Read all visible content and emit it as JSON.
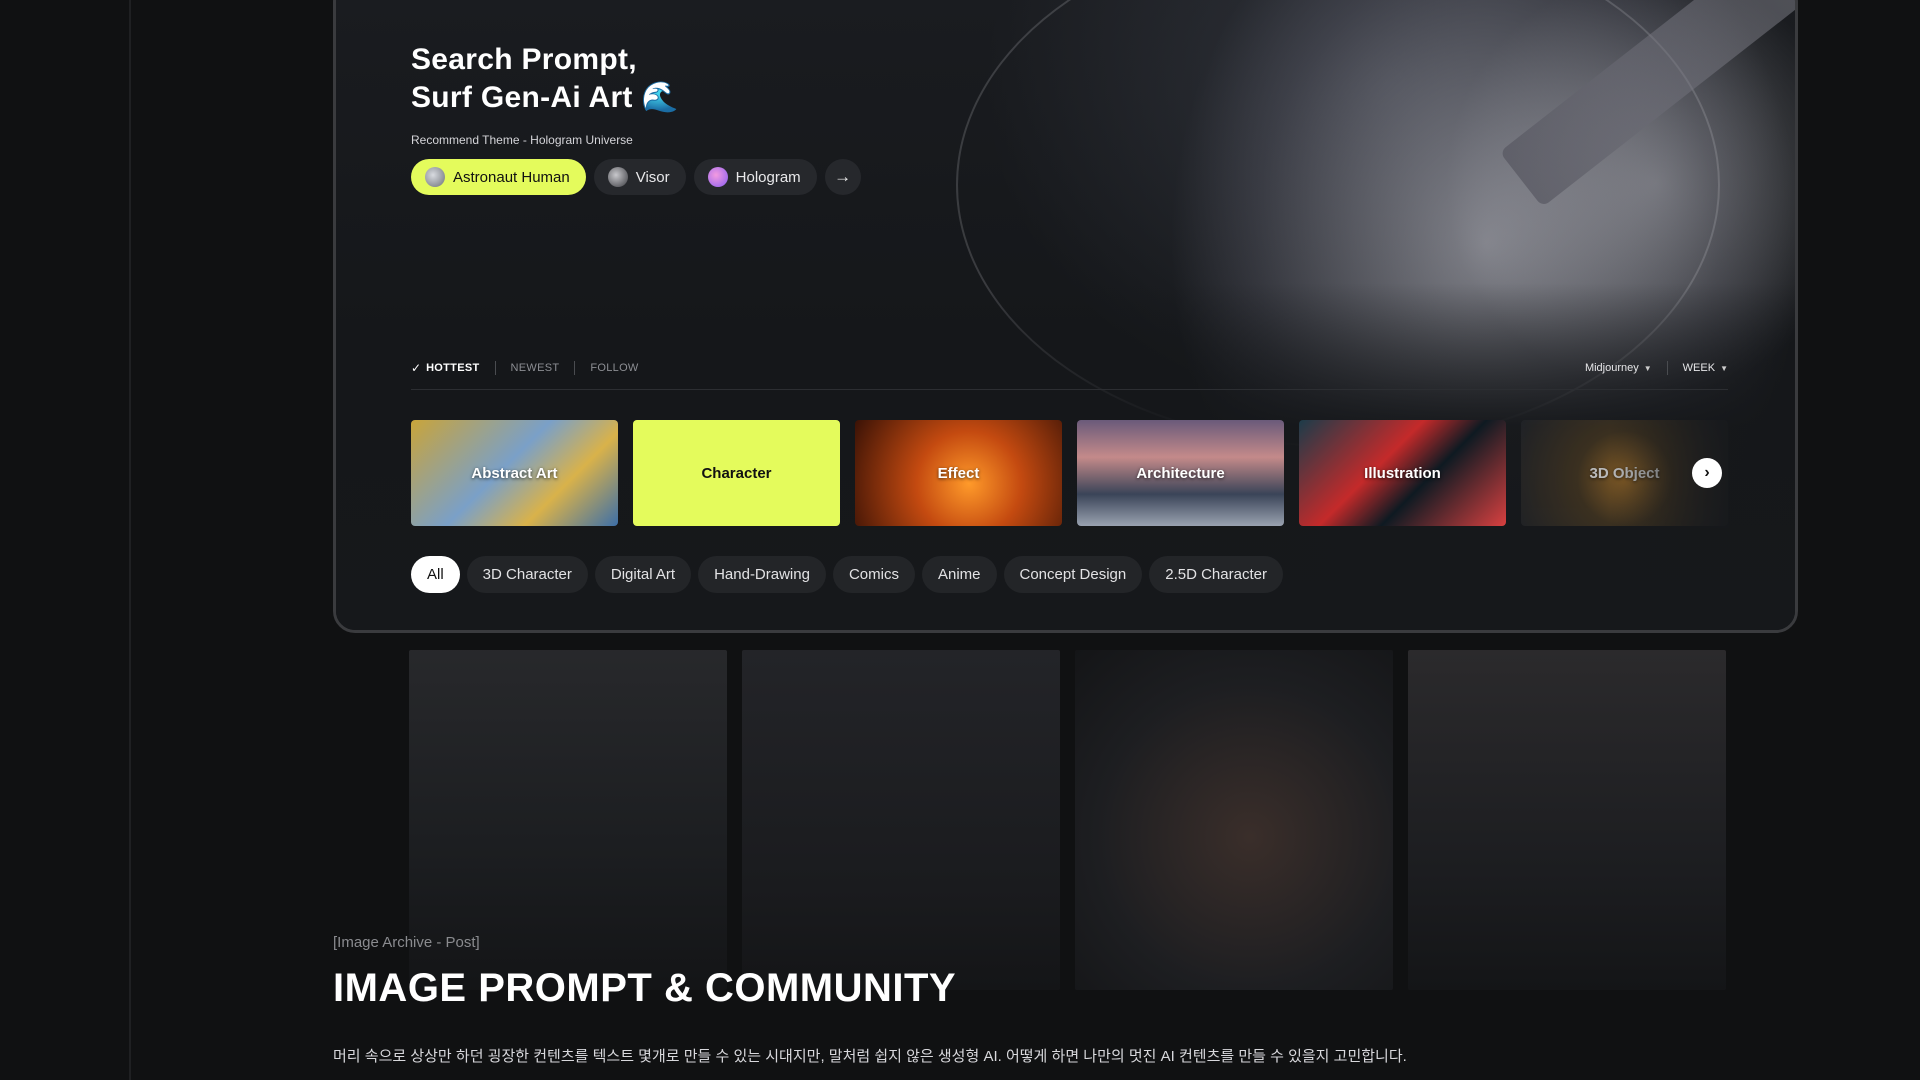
{
  "hero": {
    "title_line1": "Search Prompt,",
    "title_line2": "Surf Gen-Ai Art",
    "title_emoji": "🌊",
    "theme_label": "Recommend Theme - Hologram Universe",
    "chips": [
      {
        "label": "Astronaut Human",
        "active": true,
        "avatar_color": "#8a8f98"
      },
      {
        "label": "Visor",
        "active": false,
        "avatar_color": "#6a6c72"
      },
      {
        "label": "Hologram",
        "active": false,
        "avatar_color": "#c37cf0"
      }
    ],
    "chips_next_icon": "arrow-right-icon"
  },
  "sort": {
    "check_icon": "✓",
    "hottest": "HOTTEST",
    "newest": "NEWEST",
    "follow": "FOLLOW",
    "model": "Midjourney",
    "period": "WEEK",
    "caret": "⌄"
  },
  "categories": [
    {
      "label": "Abstract Art",
      "active": false,
      "bg": "linear-gradient(135deg,#c9a43a 0%,#7aa0c8 45%,#d9b24a 70%,#3d6fa8 100%)"
    },
    {
      "label": "Character",
      "active": true,
      "bg": "#e4fb5c"
    },
    {
      "label": "Effect",
      "active": false,
      "bg": "radial-gradient(circle at 55% 60%,#ff9a2a 0%,#c44a10 40%,#3a1206 100%)"
    },
    {
      "label": "Architecture",
      "active": false,
      "bg": "linear-gradient(180deg,#6a5a7a 0%,#c48a8a 35%,#3a4458 70%,#9aa2b0 100%)"
    },
    {
      "label": "Illustration",
      "active": false,
      "bg": "linear-gradient(135deg,#1c3c4a 0%,#c42a2a 40%,#0e1a22 60%,#d84040 100%)"
    },
    {
      "label": "3D Object",
      "active": false,
      "bg": "radial-gradient(circle at 50% 55%,#b0782a 0%,#4a3a22 40%,#22252a 100%)"
    }
  ],
  "categories_next_icon": "›",
  "tags": [
    "All",
    "3D Character",
    "Digital Art",
    "Hand-Drawing",
    "Comics",
    "Anime",
    "Concept Design",
    "2.5D Character"
  ],
  "section": {
    "kicker": "[Image Archive - Post]",
    "title": "IMAGE PROMPT & COMMUNITY",
    "description": "머리 속으로 상상만 하던 굉장한 컨텐츠를 텍스트 몇개로 만들 수 있는 시대지만, 말처럼 쉽지 않은 생성형 AI. 어떻게 하면 나만의 멋진 AI 컨텐츠를 만들 수 있을지 고민합니다."
  },
  "colors": {
    "accent": "#e4fb5c",
    "background": "#101112"
  }
}
